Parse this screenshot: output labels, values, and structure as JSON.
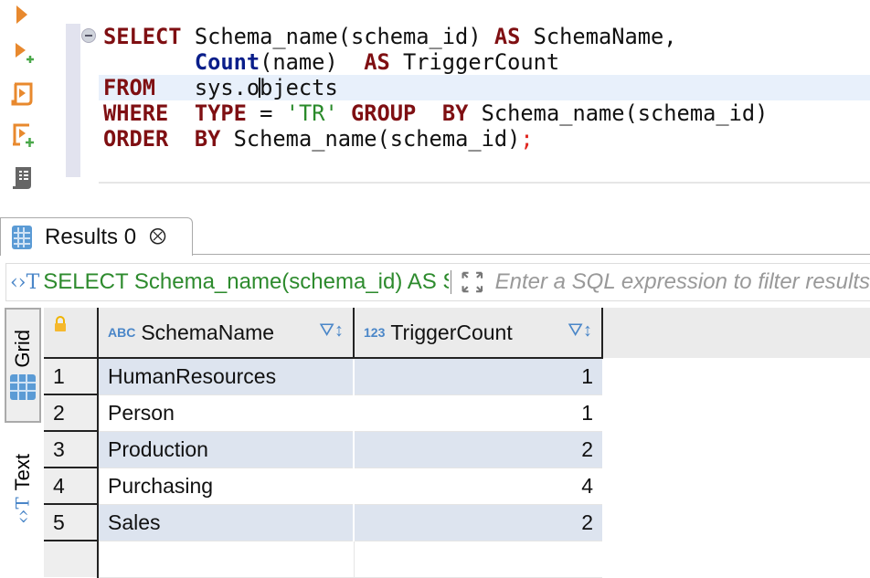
{
  "toolbar": {
    "icons": [
      "execute-statement",
      "execute-in-new-tab",
      "execute-script",
      "execute-script-new-tab",
      "explain-plan"
    ]
  },
  "editor": {
    "lines": [
      [
        {
          "t": "SELECT",
          "c": "kw"
        },
        {
          "t": " Schema_name(schema_id) ",
          "c": "id"
        },
        {
          "t": "AS",
          "c": "kw"
        },
        {
          "t": " SchemaName,",
          "c": "id"
        }
      ],
      [
        {
          "t": "       ",
          "c": "id"
        },
        {
          "t": "Count",
          "c": "fn"
        },
        {
          "t": "(name)  ",
          "c": "id"
        },
        {
          "t": "AS",
          "c": "kw"
        },
        {
          "t": " TriggerCount",
          "c": "id"
        }
      ],
      [
        {
          "t": "FROM",
          "c": "kw"
        },
        {
          "t": "   sys.o",
          "c": "id"
        },
        {
          "t": "|",
          "c": "caret"
        },
        {
          "t": "bjects",
          "c": "id"
        }
      ],
      [
        {
          "t": "WHERE",
          "c": "kw"
        },
        {
          "t": "  ",
          "c": "id"
        },
        {
          "t": "TYPE",
          "c": "kw"
        },
        {
          "t": " = ",
          "c": "id"
        },
        {
          "t": "'TR'",
          "c": "str"
        },
        {
          "t": " ",
          "c": "id"
        },
        {
          "t": "GROUP",
          "c": "kw"
        },
        {
          "t": "  ",
          "c": "id"
        },
        {
          "t": "BY",
          "c": "kw"
        },
        {
          "t": " Schema_name(schema_id)",
          "c": "id"
        }
      ],
      [
        {
          "t": "ORDER",
          "c": "kw"
        },
        {
          "t": "  ",
          "c": "id"
        },
        {
          "t": "BY",
          "c": "kw"
        },
        {
          "t": " Schema_name(schema_id)",
          "c": "id"
        },
        {
          "t": ";",
          "c": "semi"
        }
      ]
    ]
  },
  "results": {
    "tab_label": "Results 0",
    "query_text": "SELECT Schema_name(schema_id) AS SchemaName, Count(name) AS TriggerCount",
    "filter_placeholder": "Enter a SQL expression to filter results",
    "view_tabs": {
      "grid": "Grid",
      "text": "Text"
    },
    "columns": [
      {
        "type": "ABC",
        "name": "SchemaName"
      },
      {
        "type": "123",
        "name": "TriggerCount"
      }
    ],
    "rows": [
      {
        "n": "1",
        "name": "HumanResources",
        "count": "1"
      },
      {
        "n": "2",
        "name": "Person",
        "count": "1"
      },
      {
        "n": "3",
        "name": "Production",
        "count": "2"
      },
      {
        "n": "4",
        "name": "Purchasing",
        "count": "4"
      },
      {
        "n": "5",
        "name": "Sales",
        "count": "2"
      }
    ]
  }
}
